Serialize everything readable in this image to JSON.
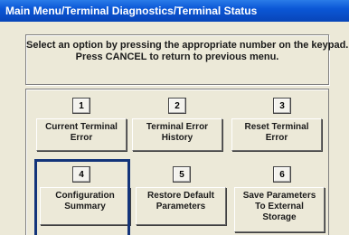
{
  "window": {
    "title": "Main Menu/Terminal Diagnostics/Terminal Status"
  },
  "instructions": {
    "line1": "Select an option by pressing the appropriate number on the keypad.",
    "line2": "Press CANCEL to return to previous menu."
  },
  "options": [
    {
      "number": "1",
      "line1": "Current Terminal",
      "line2": "Error",
      "line3": ""
    },
    {
      "number": "2",
      "line1": "Terminal Error",
      "line2": "History",
      "line3": ""
    },
    {
      "number": "3",
      "line1": "Reset Terminal",
      "line2": "Error",
      "line3": ""
    },
    {
      "number": "4",
      "line1": "Configuration",
      "line2": "Summary",
      "line3": ""
    },
    {
      "number": "5",
      "line1": "Restore Default",
      "line2": "Parameters",
      "line3": ""
    },
    {
      "number": "6",
      "line1": "Save Parameters",
      "line2": "To External",
      "line3": "Storage"
    }
  ],
  "highlighted_option": "4",
  "colors": {
    "titlebar": "#0b57d6",
    "background": "#ece9d8",
    "highlight": "#13347a"
  }
}
